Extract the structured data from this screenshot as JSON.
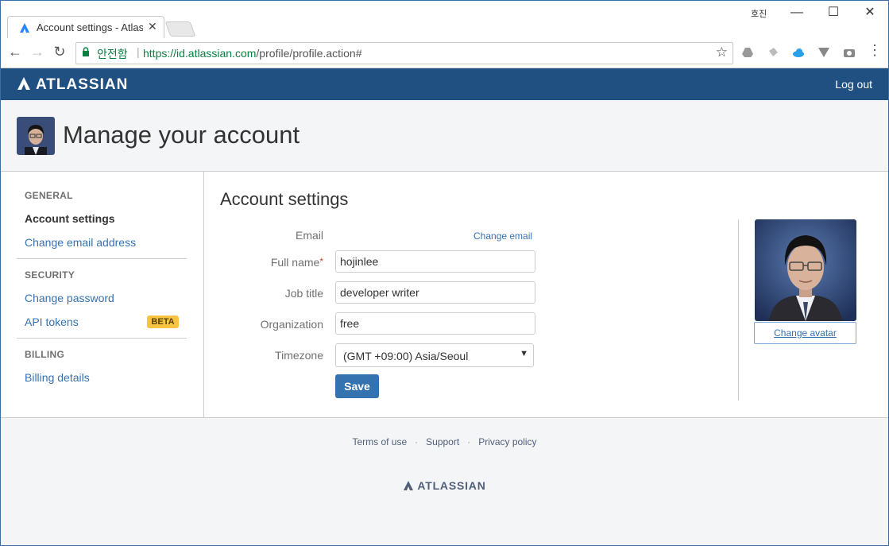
{
  "browser": {
    "tab_title": "Account settings - Atlas",
    "profile_label": "호진",
    "secure_label": "안전함",
    "url_host": "https://id.atlassian.com",
    "url_path": "/profile/profile.action#"
  },
  "header": {
    "brand": "ATLASSIAN",
    "logout": "Log out"
  },
  "page": {
    "title": "Manage your account"
  },
  "sidebar": {
    "general_heading": "GENERAL",
    "account_settings": "Account settings",
    "change_email": "Change email address",
    "security_heading": "SECURITY",
    "change_password": "Change password",
    "api_tokens": "API tokens",
    "beta_badge": "BETA",
    "billing_heading": "BILLING",
    "billing_details": "Billing details"
  },
  "form": {
    "section_title": "Account settings",
    "email_label": "Email",
    "change_email_link": "Change email",
    "fullname_label": "Full name",
    "required_mark": "*",
    "fullname_value": "hojinlee",
    "jobtitle_label": "Job title",
    "jobtitle_value": "developer writer",
    "organization_label": "Organization",
    "organization_value": "free",
    "timezone_label": "Timezone",
    "timezone_value": "(GMT +09:00) Asia/Seoul",
    "save_label": "Save",
    "change_avatar": "Change avatar"
  },
  "footer": {
    "terms": "Terms of use",
    "support": "Support",
    "privacy": "Privacy policy",
    "dot": "·",
    "brand": "ATLASSIAN"
  },
  "colors": {
    "header_bg": "#205081",
    "link": "#3572b0",
    "beta_bg": "#f6c342",
    "save_bg": "#3572b0"
  }
}
